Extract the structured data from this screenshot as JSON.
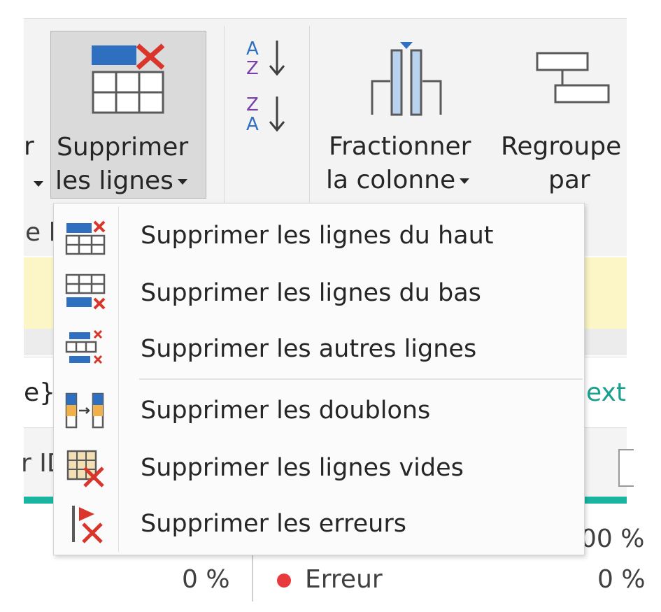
{
  "ribbon": {
    "partial_left_button": {
      "line1": "r"
    },
    "remove_rows_button": {
      "line1": "Supprimer",
      "line2": "les lignes"
    },
    "sort": {
      "asc_top": "A",
      "asc_bottom": "Z",
      "desc_top": "Z",
      "desc_bottom": "A"
    },
    "split_column_button": {
      "line1": "Fractionner",
      "line2": "la colonne"
    },
    "group_by_button": {
      "line1": "Regroupe",
      "line2": "par"
    },
    "group_label_partial": "e l"
  },
  "background": {
    "formula_left": "e}",
    "formula_right": "ext",
    "header_left": "r ID",
    "row1_right": "00 %",
    "row2_left": "0 %",
    "row2_status": "Erreur",
    "row2_right": "0 %",
    "status_color": "#e8393c",
    "accent_teal": "#19b5a0"
  },
  "menu": {
    "items": [
      {
        "label": "Supprimer les lignes du haut",
        "icon": "remove-top-rows-icon"
      },
      {
        "label": "Supprimer les lignes du bas",
        "icon": "remove-bottom-rows-icon"
      },
      {
        "label": "Supprimer les autres lignes",
        "icon": "remove-alternate-rows-icon"
      },
      {
        "label": "Supprimer les doublons",
        "icon": "remove-duplicates-icon"
      },
      {
        "label": "Supprimer les lignes vides",
        "icon": "remove-blank-rows-icon"
      },
      {
        "label": "Supprimer les erreurs",
        "icon": "remove-errors-icon"
      }
    ]
  },
  "colors": {
    "accent_blue": "#2f6fbf",
    "delete_red": "#d9352a",
    "highlight": "#fcf6c6"
  }
}
